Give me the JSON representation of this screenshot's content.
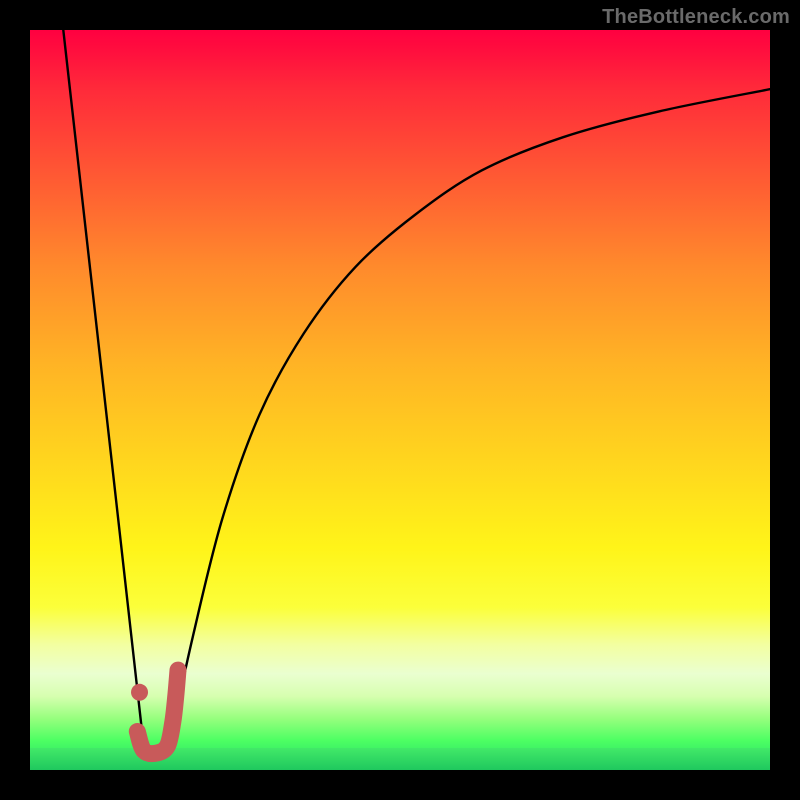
{
  "watermark": "TheBottleneck.com",
  "colors": {
    "frame": "#000000",
    "curve": "#000000",
    "marker_fill": "#c85a5a",
    "marker_stroke": "#a84444",
    "gradient_top": "#ff0040",
    "gradient_bottom": "#1fd867"
  },
  "chart_data": {
    "type": "line",
    "title": "",
    "xlabel": "",
    "ylabel": "",
    "xlim": [
      0,
      100
    ],
    "ylim": [
      0,
      100
    ],
    "series": [
      {
        "name": "left-branch",
        "x": [
          4.5,
          15.5
        ],
        "y": [
          100,
          2
        ]
      },
      {
        "name": "right-branch",
        "x": [
          18.5,
          22,
          26,
          31,
          37,
          44,
          52,
          61,
          72,
          85,
          100
        ],
        "y": [
          2,
          18,
          34,
          48,
          59,
          68,
          75,
          81,
          85.5,
          89,
          92
        ]
      }
    ],
    "markers": {
      "type": "j-shape",
      "points": [
        {
          "x": 14.8,
          "y": 10.5
        },
        {
          "x": 14.5,
          "y": 5.2
        },
        {
          "x": 15.4,
          "y": 2.6
        },
        {
          "x": 17.2,
          "y": 2.3
        },
        {
          "x": 18.6,
          "y": 3.3
        },
        {
          "x": 19.3,
          "y": 6.5
        },
        {
          "x": 19.7,
          "y": 10.0
        },
        {
          "x": 20.0,
          "y": 13.5
        }
      ]
    }
  }
}
